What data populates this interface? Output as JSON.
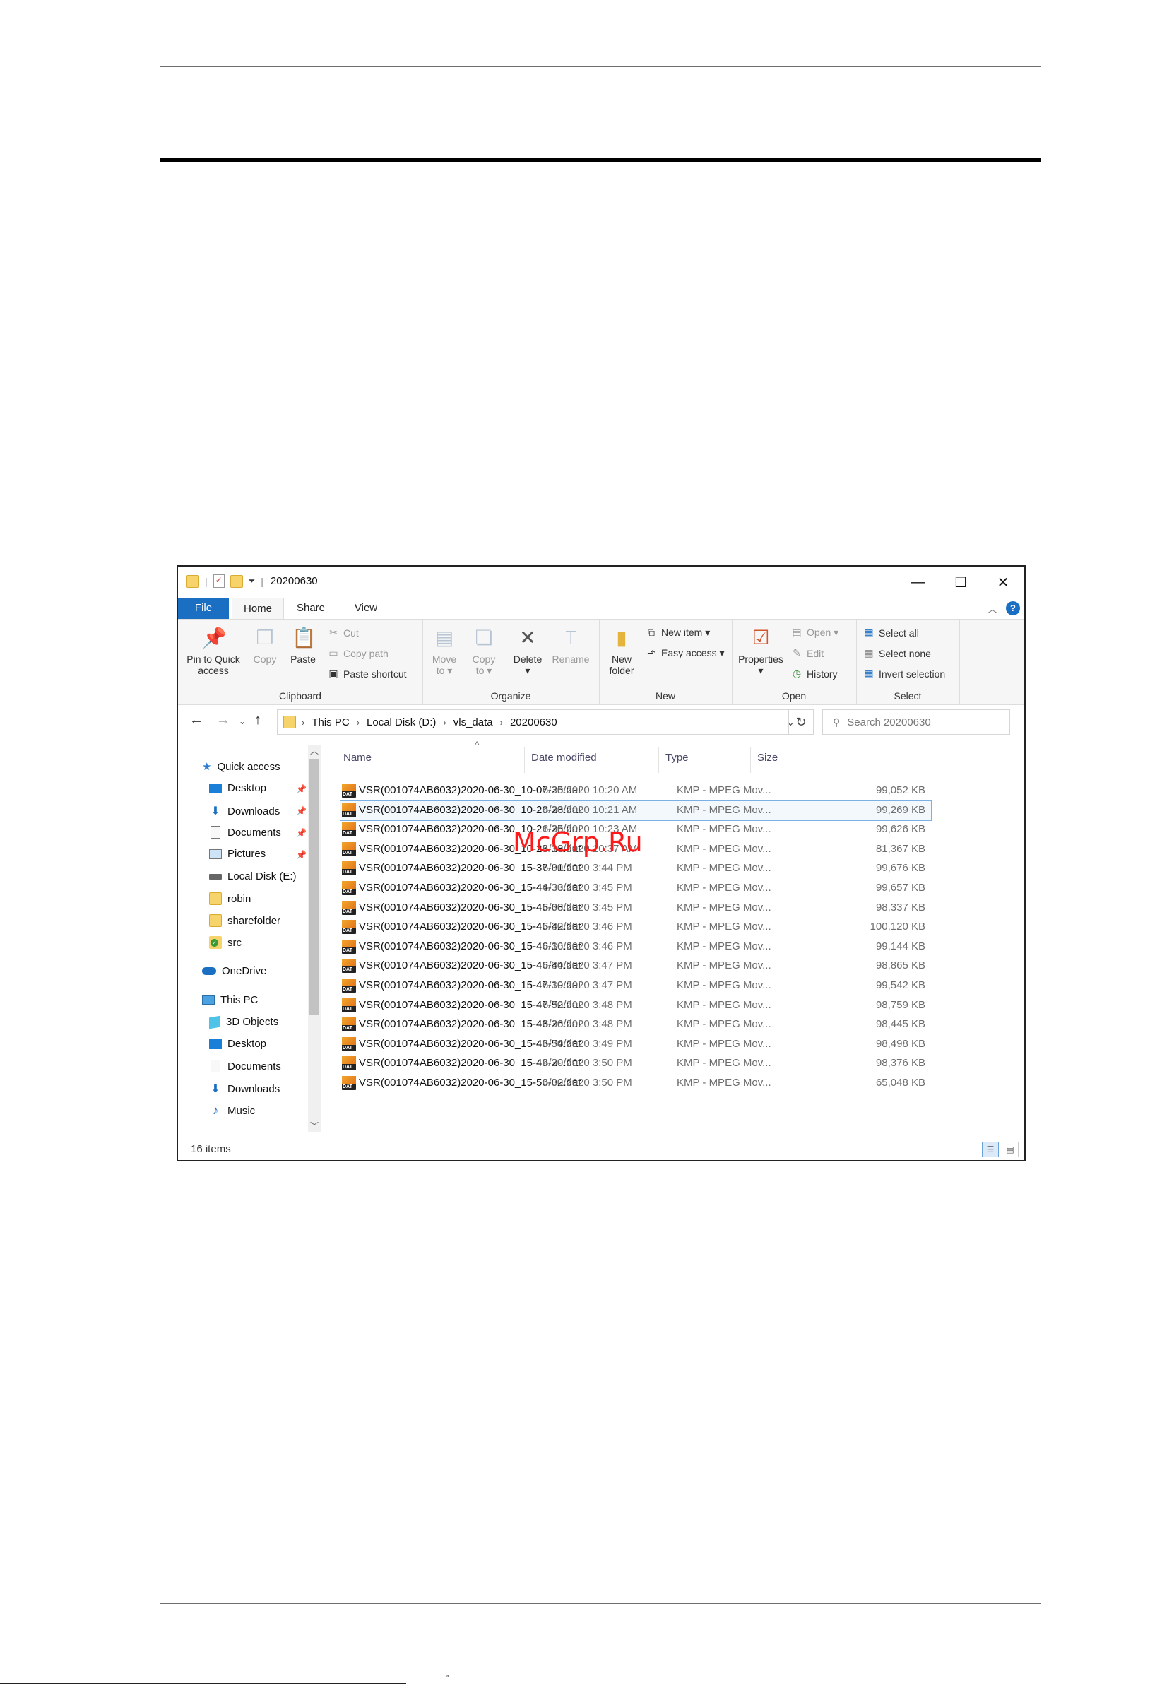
{
  "window": {
    "title": "20200630",
    "controls": {
      "minimize": "—",
      "maximize": "☐",
      "close": "✕"
    }
  },
  "tabs": [
    "File",
    "Home",
    "Share",
    "View"
  ],
  "ribbon": {
    "clipboard": {
      "label": "Clipboard",
      "pin_line1": "Pin to Quick",
      "pin_line2": "access",
      "copy": "Copy",
      "paste": "Paste",
      "cut": "Cut",
      "copy_path": "Copy path",
      "paste_shortcut": "Paste shortcut"
    },
    "organize": {
      "label": "Organize",
      "move_line1": "Move",
      "move_line2": "to ▾",
      "copy_line1": "Copy",
      "copy_line2": "to ▾",
      "delete": "Delete",
      "delete_caret": "▾",
      "rename": "Rename"
    },
    "new": {
      "label": "New",
      "folder_line1": "New",
      "folder_line2": "folder",
      "new_item": "New item ▾",
      "easy_access": "Easy access ▾"
    },
    "open": {
      "label": "Open",
      "properties": "Properties",
      "properties_caret": "▾",
      "open": "Open ▾",
      "edit": "Edit",
      "history": "History"
    },
    "select": {
      "label": "Select",
      "select_all": "Select all",
      "select_none": "Select none",
      "invert": "Invert selection"
    }
  },
  "address": {
    "crumbs": [
      "This PC",
      "Local Disk (D:)",
      "vls_data",
      "20200630"
    ],
    "search_placeholder": "Search 20200630"
  },
  "nav": {
    "quick_access": "Quick access",
    "quick_items": [
      "Desktop",
      "Downloads",
      "Documents",
      "Pictures",
      "Local Disk (E:)",
      "robin",
      "sharefolder",
      "src"
    ],
    "onedrive": "OneDrive",
    "this_pc": "This PC",
    "pc_items": [
      "3D Objects",
      "Desktop",
      "Documents",
      "Downloads",
      "Music"
    ]
  },
  "columns": {
    "name": "Name",
    "date": "Date modified",
    "type": "Type",
    "size": "Size"
  },
  "files": [
    {
      "name": "VSR(001074AB6032)2020-06-30_10-07-25.dat",
      "date": "6/30/2020 10:20 AM",
      "type": "KMP - MPEG Mov...",
      "size": "99,052 KB"
    },
    {
      "name": "VSR(001074AB6032)2020-06-30_10-20-23.dat",
      "date": "6/30/2020 10:21 AM",
      "type": "KMP - MPEG Mov...",
      "size": "99,269 KB"
    },
    {
      "name": "VSR(001074AB6032)2020-06-30_10-21-25.dat",
      "date": "6/30/2020 10:23 AM",
      "type": "KMP - MPEG Mov...",
      "size": "99,626 KB"
    },
    {
      "name": "VSR(001074AB6032)2020-06-30_10-23-18.dat",
      "date": "6/30/2020 10:37 AM",
      "type": "KMP - MPEG Mov...",
      "size": "81,367 KB"
    },
    {
      "name": "VSR(001074AB6032)2020-06-30_15-37-01.dat",
      "date": "6/30/2020 3:44 PM",
      "type": "KMP - MPEG Mov...",
      "size": "99,676 KB"
    },
    {
      "name": "VSR(001074AB6032)2020-06-30_15-44-33.dat",
      "date": "6/30/2020 3:45 PM",
      "type": "KMP - MPEG Mov...",
      "size": "99,657 KB"
    },
    {
      "name": "VSR(001074AB6032)2020-06-30_15-45-08.dat",
      "date": "6/30/2020 3:45 PM",
      "type": "KMP - MPEG Mov...",
      "size": "98,337 KB"
    },
    {
      "name": "VSR(001074AB6032)2020-06-30_15-45-42.dat",
      "date": "6/30/2020 3:46 PM",
      "type": "KMP - MPEG Mov...",
      "size": "100,120 KB"
    },
    {
      "name": "VSR(001074AB6032)2020-06-30_15-46-16.dat",
      "date": "6/30/2020 3:46 PM",
      "type": "KMP - MPEG Mov...",
      "size": "99,144 KB"
    },
    {
      "name": "VSR(001074AB6032)2020-06-30_15-46-44.dat",
      "date": "6/30/2020 3:47 PM",
      "type": "KMP - MPEG Mov...",
      "size": "98,865 KB"
    },
    {
      "name": "VSR(001074AB6032)2020-06-30_15-47-19.dat",
      "date": "6/30/2020 3:47 PM",
      "type": "KMP - MPEG Mov...",
      "size": "99,542 KB"
    },
    {
      "name": "VSR(001074AB6032)2020-06-30_15-47-52.dat",
      "date": "6/30/2020 3:48 PM",
      "type": "KMP - MPEG Mov...",
      "size": "98,759 KB"
    },
    {
      "name": "VSR(001074AB6032)2020-06-30_15-48-26.dat",
      "date": "6/30/2020 3:48 PM",
      "type": "KMP - MPEG Mov...",
      "size": "98,445 KB"
    },
    {
      "name": "VSR(001074AB6032)2020-06-30_15-48-54.dat",
      "date": "6/30/2020 3:49 PM",
      "type": "KMP - MPEG Mov...",
      "size": "98,498 KB"
    },
    {
      "name": "VSR(001074AB6032)2020-06-30_15-49-29.dat",
      "date": "6/30/2020 3:50 PM",
      "type": "KMP - MPEG Mov...",
      "size": "98,376 KB"
    },
    {
      "name": "VSR(001074AB6032)2020-06-30_15-50-02.dat",
      "date": "6/30/2020 3:50 PM",
      "type": "KMP - MPEG Mov...",
      "size": "65,048 KB"
    }
  ],
  "status": {
    "count": "16 items"
  },
  "watermark": "McGrp.Ru",
  "footer_mark": "″"
}
